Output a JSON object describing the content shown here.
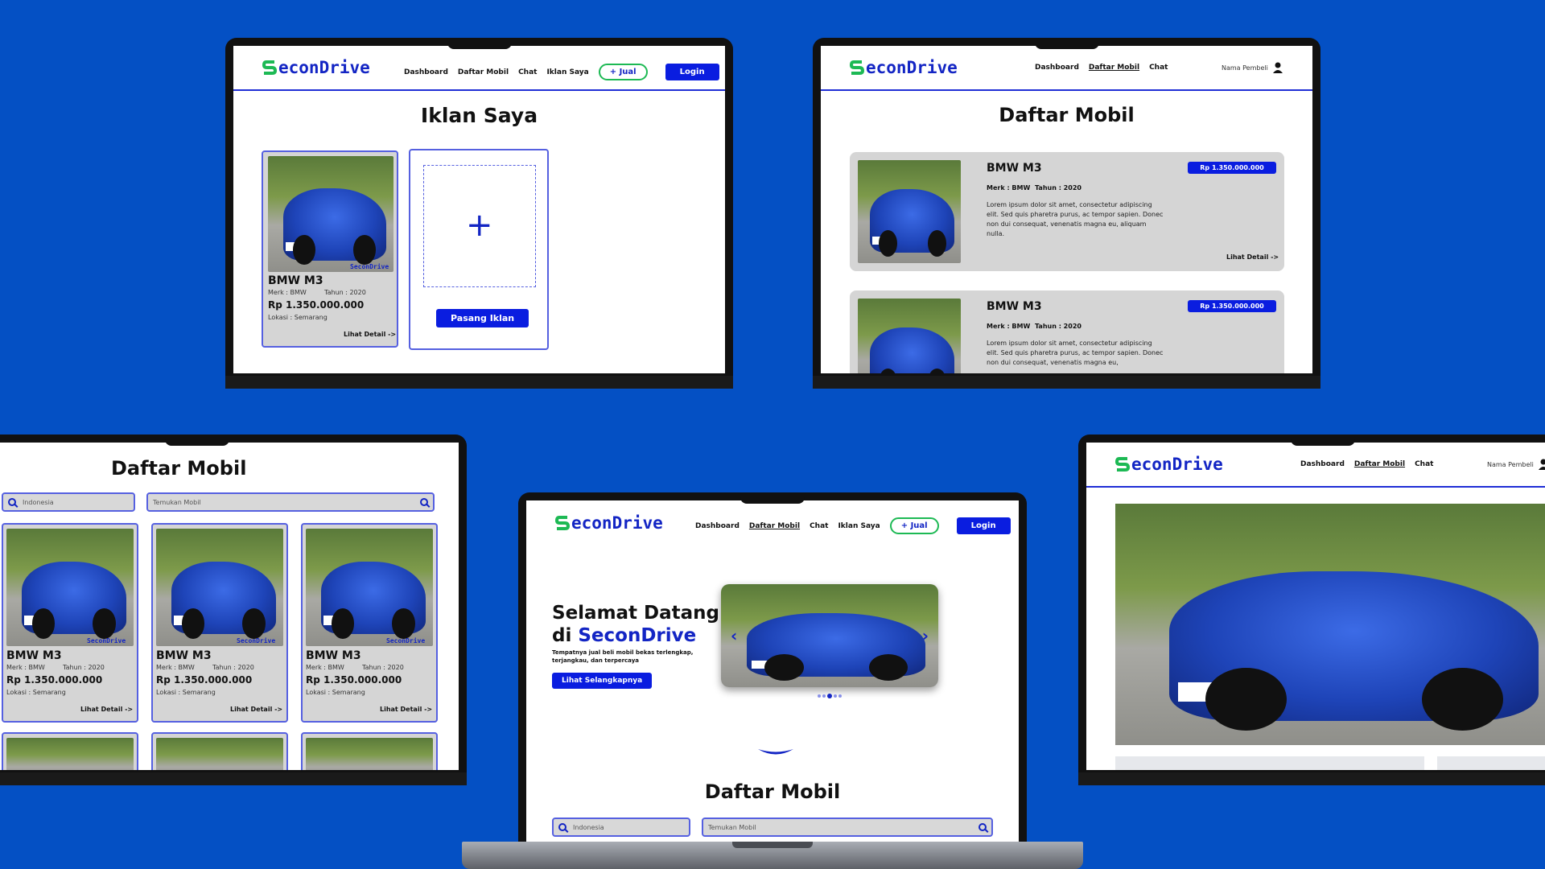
{
  "brand": {
    "logo": "SeconDrive",
    "logo_text": "econDrive",
    "accent": "#0a1de0",
    "background": "#0450c4"
  },
  "nav": {
    "dashboard": "Dashboard",
    "daftar_mobil": "Daftar Mobil",
    "chat": "Chat",
    "iklan_saya": "Iklan Saya",
    "jual": "+ Jual",
    "login": "Login",
    "user_name": "Nama Pembeli"
  },
  "iklan": {
    "title": "Iklan Saya",
    "pasang": "Pasang Iklan"
  },
  "car": {
    "name": "BMW M3",
    "merk": "Merk : BMW",
    "tahun": "Tahun : 2020",
    "price": "Rp 1.350.000.000",
    "lokasi": "Lokasi : Semarang",
    "detail": "Lihat Detail ->",
    "price_badge": "Rp 1.350.000.000"
  },
  "daftar": {
    "title": "Daftar Mobil",
    "lorem": "Lorem ipsum dolor sit amet, consectetur adipiscing elit. Sed quis pharetra purus, ac tempor sapien. Donec non dui consequat, venenatis magna eu, aliquam nulla.",
    "lorem_short": "Lorem ipsum dolor sit amet, consectetur adipiscing elit. Sed quis pharetra purus, ac tempor sapien. Donec non dui consequat, venenatis magna eu,"
  },
  "search": {
    "location": "Indonesia",
    "placeholder": "Temukan Mobil"
  },
  "hero": {
    "line1": "Selamat Datang",
    "line2_prefix": "di ",
    "line2_brand": "SeconDrive",
    "sub": "Tempatnya jual beli mobil bekas terlengkap, terjangkau, dan terpercaya",
    "cta": "Lihat Selangkapnya",
    "dots": 5,
    "active_dot": 3
  }
}
